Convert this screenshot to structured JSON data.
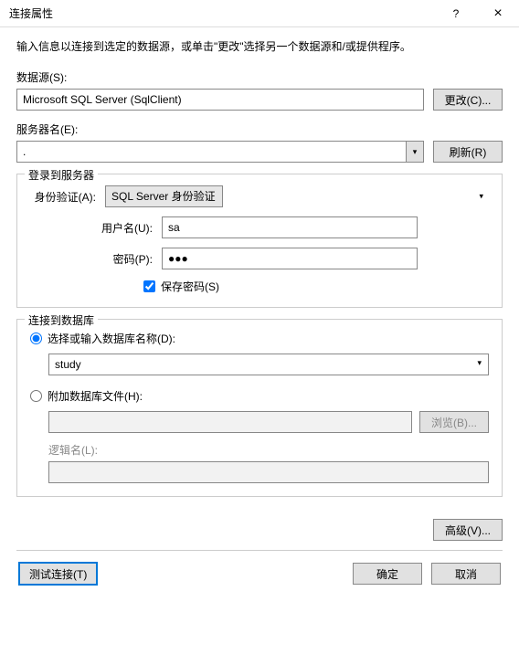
{
  "titlebar": {
    "title": "连接属性",
    "help": "?",
    "close": "×"
  },
  "intro": "输入信息以连接到选定的数据源，或单击\"更改\"选择另一个数据源和/或提供程序。",
  "datasource": {
    "label": "数据源(S):",
    "value": "Microsoft SQL Server (SqlClient)",
    "change_btn": "更改(C)..."
  },
  "server": {
    "label": "服务器名(E):",
    "value": ".",
    "refresh_btn": "刷新(R)"
  },
  "login": {
    "legend": "登录到服务器",
    "auth_label": "身份验证(A):",
    "auth_value": "SQL Server 身份验证",
    "user_label": "用户名(U):",
    "user_value": "sa",
    "pass_label": "密码(P):",
    "pass_value": "●●●",
    "save_pass": "保存密码(S)"
  },
  "database": {
    "legend": "连接到数据库",
    "select_radio": "选择或输入数据库名称(D):",
    "db_value": "study",
    "attach_radio": "附加数据库文件(H):",
    "browse_btn": "浏览(B)...",
    "logical_label": "逻辑名(L):"
  },
  "advanced_btn": "高级(V)...",
  "footer": {
    "test_btn": "测试连接(T)",
    "ok_btn": "确定",
    "cancel_btn": "取消"
  }
}
